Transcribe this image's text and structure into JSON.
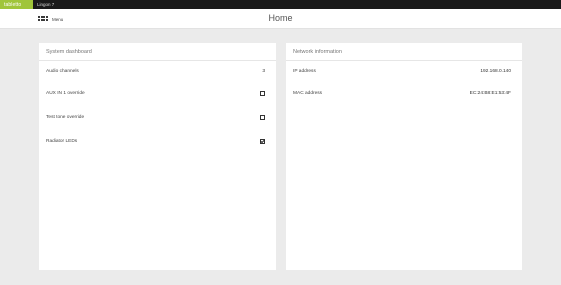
{
  "topbar": {
    "brand": "tabletto",
    "device_tab": "Lingon 7"
  },
  "header": {
    "menu_icon": "grid-menu-icon",
    "menu_label": "Menu",
    "title": "Home"
  },
  "system_dashboard": {
    "title": "System dashboard",
    "audio_channels_label": "Audio channels",
    "audio_channels_value": "3",
    "aux_override_label": "AUX IN 1 override",
    "aux_override_checked": false,
    "test_tone_label": "Test tone override",
    "test_tone_checked": false,
    "radiator_leds_label": "Radiator LEDs",
    "radiator_leds_checked": true
  },
  "network_information": {
    "title": "Network information",
    "ip_label": "IP address",
    "ip_value": "192.168.0.140",
    "mac_label": "MAC address",
    "mac_value": "EC:24:B8:E1:53:4F"
  },
  "colors": {
    "brand": "#a0c53a",
    "topbar": "#1a1a1a",
    "background": "#ebebeb",
    "card": "#ffffff"
  }
}
